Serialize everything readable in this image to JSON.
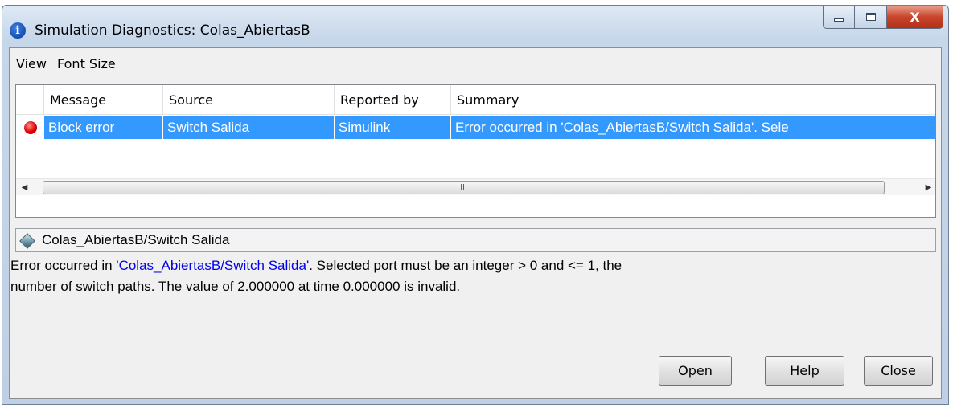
{
  "window": {
    "title": "Simulation Diagnostics: Colas_AbiertasB",
    "minimize": "minimize",
    "maximize": "maximize",
    "close": "X"
  },
  "menu": {
    "items": [
      "View",
      "Font Size"
    ]
  },
  "table": {
    "columns": [
      "Message",
      "Source",
      "Reported by",
      "Summary"
    ],
    "rows": [
      {
        "status_icon": "error-dot-icon",
        "message": "Block error",
        "source": "Switch Salida",
        "reported_by": "Simulink",
        "summary": "Error occurred in 'Colas_AbiertasB/Switch Salida'.  Sele"
      }
    ],
    "scroll_thumb_glyph": "III"
  },
  "detail": {
    "path": "Colas_AbiertasB/Switch Salida",
    "message_prefix": "Error occurred in ",
    "message_link": "'Colas_AbiertasB/Switch Salida'",
    "message_line1_rest": ".  Selected port must be an integer > 0 and <= 1, the",
    "message_line2": "number of switch paths. The value of 2.000000 at time 0.000000 is invalid."
  },
  "buttons": {
    "open": "Open",
    "help": "Help",
    "close": "Close"
  },
  "colors": {
    "selection": "#3399ff",
    "link": "#0000ee",
    "error": "#e00000",
    "close_button": "#c9452b"
  }
}
